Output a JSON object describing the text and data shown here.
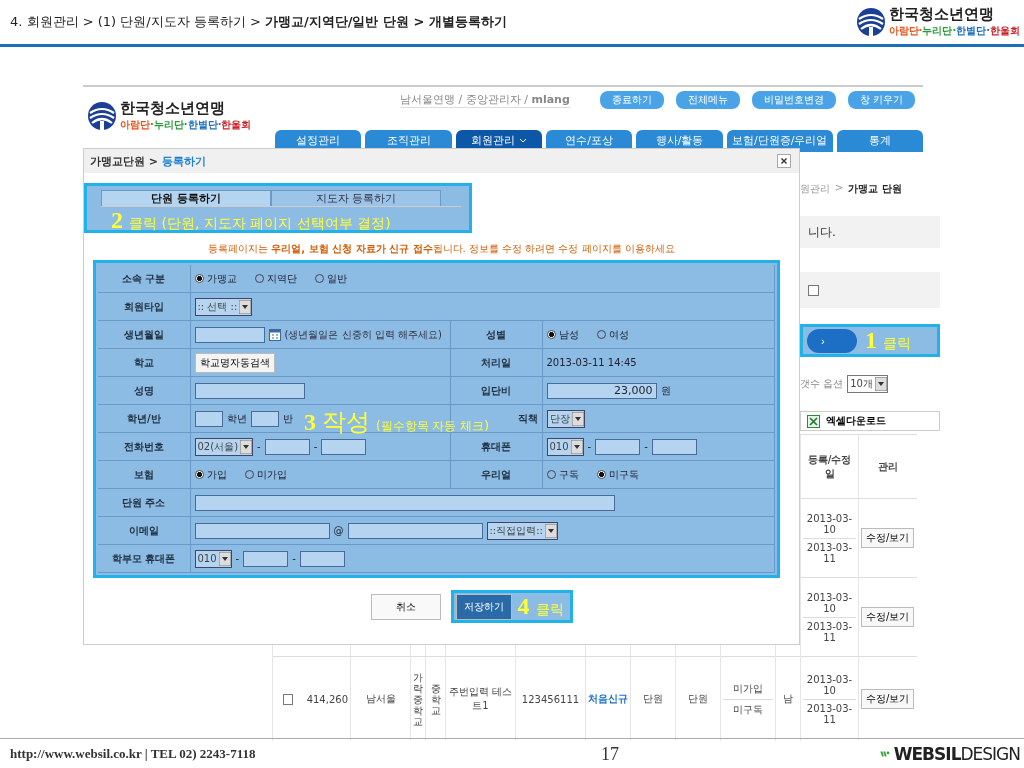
{
  "slide_header": {
    "breadcrumb": "4. 회원관리 > (1) 단원/지도자 등록하기 > **가맹교/지역단/일반 단원 > 개별등록하기**",
    "logo": {
      "name": "한국청소년연맹",
      "groups": [
        {
          "text": "아람단·",
          "color": "#e8541c"
        },
        {
          "text": "누리단·",
          "color": "#2a9a3a"
        },
        {
          "text": "한별단·",
          "color": "#1f6fc0"
        },
        {
          "text": "한울회",
          "color": "#d0202a"
        }
      ]
    }
  },
  "app": {
    "logo": {
      "name": "한국청소년연맹",
      "groups": [
        {
          "text": "아람단·",
          "color": "#e8541c"
        },
        {
          "text": "누리단·",
          "color": "#2a9a3a"
        },
        {
          "text": "한별단·",
          "color": "#1f6fc0"
        },
        {
          "text": "한울회",
          "color": "#d0202a"
        }
      ]
    },
    "user_info": "남서울연맹 / 중앙관리자 / **mlang**",
    "top_buttons": [
      "종료하기",
      "전체메뉴",
      "비밀번호변경",
      "창 키우기"
    ],
    "nav": [
      {
        "label": "설정관리",
        "selected": false
      },
      {
        "label": "조직관리",
        "selected": false
      },
      {
        "label": "회원관리",
        "selected": true
      },
      {
        "label": "연수/포상",
        "selected": false
      },
      {
        "label": "행사/활동",
        "selected": false
      },
      {
        "label": "보험/단원증/우리얼",
        "selected": false
      },
      {
        "label": "통계",
        "selected": false
      }
    ],
    "breadcrumb": {
      "separator": ">",
      "items": [
        "원관리",
        "가맹교 단원"
      ]
    },
    "notice_text": "니다.",
    "filter_checkbox": {
      "checked": false
    },
    "register_button": {
      "label": "›"
    },
    "page_size": {
      "label": "갯수 옵션",
      "value": "10개"
    },
    "excel_button": "엑셀다운로드",
    "table": {
      "columns": [
        "등록/수정일",
        "관리"
      ],
      "rows": [
        {
          "kind": "partial",
          "dates": [
            "2013-03-10",
            "2013-03-11"
          ],
          "action": "수정/보기"
        },
        {
          "kind": "partial",
          "dates": [
            "2013-03-10",
            "2013-03-11"
          ],
          "action": "수정/보기"
        },
        {
          "kind": "full",
          "checked": false,
          "number": "414,260",
          "region": "남서울",
          "school": "가락중학교",
          "level": "중학교",
          "name": "주번입력 테스트1",
          "code": "123456111",
          "status": "처음신규",
          "column_9": "단원",
          "column_10": "단원",
          "insurance": "미가입",
          "subscription": "미구독",
          "gender": "남",
          "dates": [
            "2013-03-10",
            "2013-03-11"
          ],
          "action": "수정/보기"
        }
      ]
    }
  },
  "modal": {
    "title": {
      "parent": "가맹교단원",
      "separator": ">",
      "current": "등록하기"
    },
    "tabs": [
      {
        "label": "단원 등록하기",
        "selected": true
      },
      {
        "label": "지도자 등록하기",
        "selected": false
      }
    ],
    "notice": "등록페이지는 **우리얼, 보험 신청 자료가 신규 접수**됩니다. 정보를 수정 하려면 수정 페이지를 이용하세요",
    "form": {
      "rows": [
        {
          "fields": [
            {
              "label": "소속 구분",
              "control": {
                "kind": "radios",
                "options": [
                  {
                    "label": "가맹교",
                    "selected": true
                  },
                  {
                    "label": "지역단",
                    "selected": false
                  },
                  {
                    "label": "일반",
                    "selected": false
                  }
                ]
              }
            }
          ]
        },
        {
          "fields": [
            {
              "label": "회원타입",
              "control": {
                "kind": "select",
                "value": ":: 선택 ::"
              }
            }
          ]
        },
        {
          "fields": [
            {
              "label": "생년월일",
              "control": {
                "kind": "date",
                "hint": "(생년월일은 신중히 입력 해주세요)"
              }
            },
            {
              "label": "성별",
              "control": {
                "kind": "radios",
                "options": [
                  {
                    "label": "남성",
                    "selected": true
                  },
                  {
                    "label": "여성",
                    "selected": false
                  }
                ]
              }
            }
          ]
        },
        {
          "fields": [
            {
              "label": "학교",
              "control": {
                "kind": "button",
                "label": "학교명자동검색"
              }
            },
            {
              "label": "처리일",
              "control": {
                "kind": "text",
                "value": "2013-03-11 14:45"
              }
            }
          ]
        },
        {
          "fields": [
            {
              "label": "성명",
              "control": {
                "kind": "input"
              }
            },
            {
              "label": "입단비",
              "control": {
                "kind": "amount",
                "value": "23,000",
                "unit": "원"
              }
            }
          ]
        },
        {
          "fields": [
            {
              "label": "학년/반",
              "control": {
                "kind": "class",
                "units": [
                  "학년",
                  "반"
                ]
              }
            },
            {
              "label": "직책",
              "control": {
                "kind": "select",
                "value": "단장"
              }
            }
          ]
        },
        {
          "fields": [
            {
              "label": "전화번호",
              "control": {
                "kind": "phone",
                "prefix": "02(서울)",
                "separators": [
                  "-",
                  "-"
                ]
              }
            },
            {
              "label": "휴대폰",
              "control": {
                "kind": "phone",
                "prefix": "010",
                "separators": [
                  "-",
                  "-"
                ]
              }
            }
          ]
        },
        {
          "fields": [
            {
              "label": "보험",
              "control": {
                "kind": "radios",
                "options": [
                  {
                    "label": "가입",
                    "selected": true
                  },
                  {
                    "label": "미가입",
                    "selected": false
                  }
                ]
              }
            },
            {
              "label": "우리얼",
              "control": {
                "kind": "radios",
                "options": [
                  {
                    "label": "구독",
                    "selected": false
                  },
                  {
                    "label": "미구독",
                    "selected": true
                  }
                ]
              }
            }
          ]
        },
        {
          "fields": [
            {
              "label": "단원 주소",
              "control": {
                "kind": "address"
              }
            }
          ]
        },
        {
          "fields": [
            {
              "label": "이메일",
              "control": {
                "kind": "email",
                "at": "@",
                "domain": "::직접입력::"
              }
            }
          ]
        },
        {
          "fields": [
            {
              "label": "학부모 휴대폰",
              "control": {
                "kind": "phone",
                "prefix": "010",
                "separators": [
                  "-",
                  "-"
                ]
              }
            }
          ]
        }
      ]
    },
    "buttons": [
      "취소",
      "저장하기"
    ]
  },
  "callouts": [
    {
      "number": "1",
      "text": "클릭"
    },
    {
      "number": "2",
      "text": "클릭 (단원, 지도자 페이지 선택여부 결정)"
    },
    {
      "number": "3",
      "text": "작성",
      "note": "(필수항목 자동 체크)"
    },
    {
      "number": "4",
      "text": "클릭"
    }
  ],
  "footer": {
    "contact": "http://www.websil.co.kr | TEL 02) 2243-7118",
    "page": "17",
    "brand": "**WEBSIL**DESIGN"
  }
}
